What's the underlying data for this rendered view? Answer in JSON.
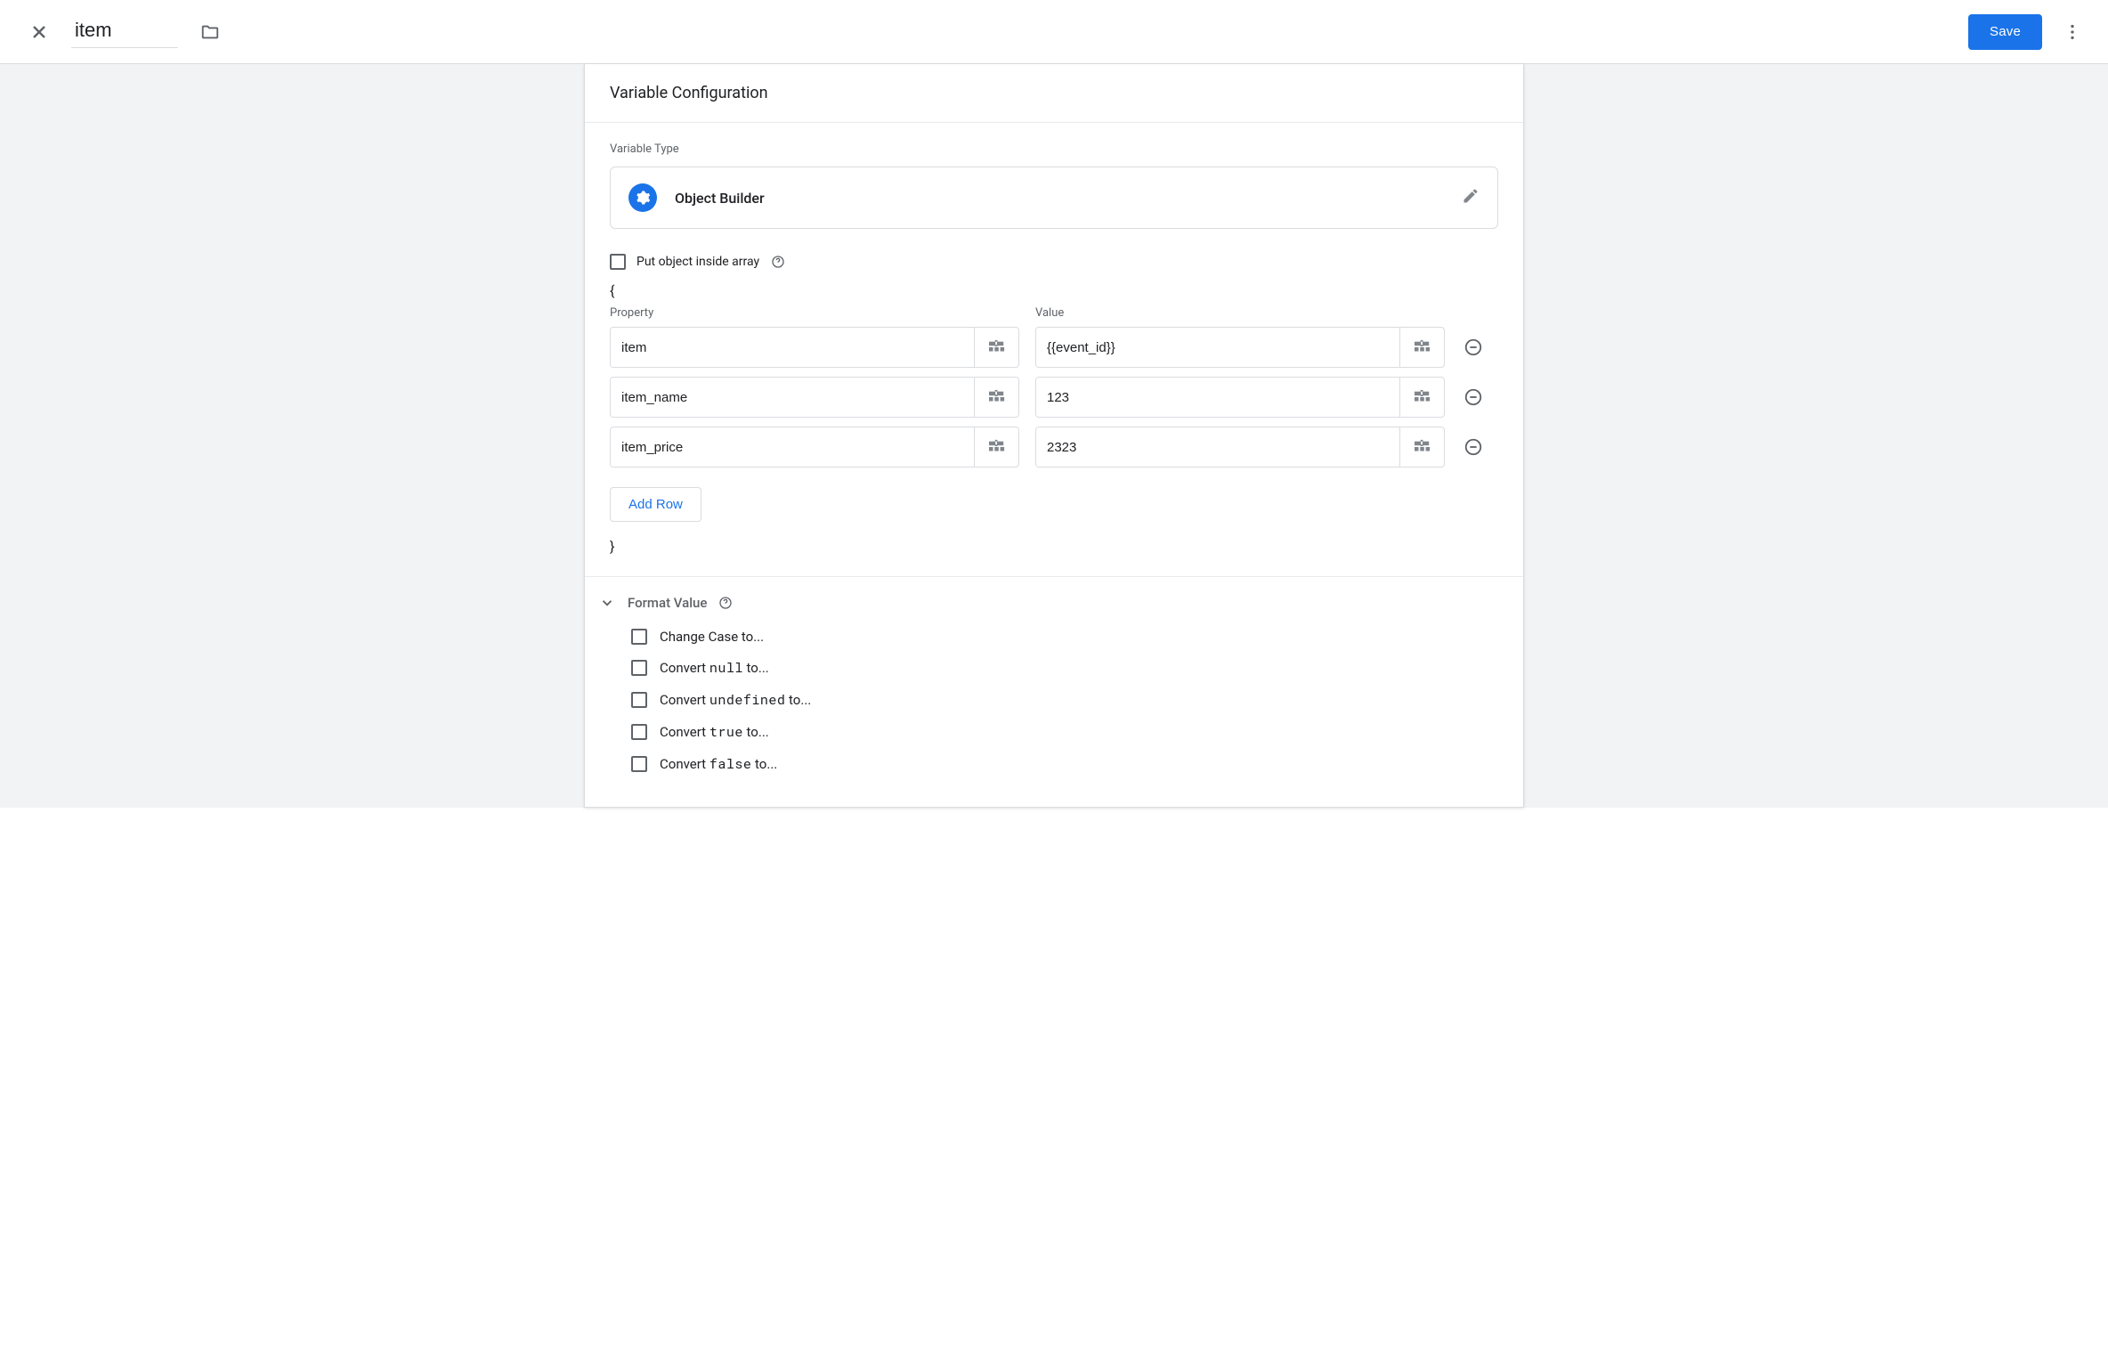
{
  "header": {
    "title_value": "item",
    "save_label": "Save"
  },
  "config": {
    "panel_title": "Variable Configuration",
    "type_label": "Variable Type",
    "type_name": "Object Builder",
    "array_checkbox_label": "Put object inside array",
    "open_brace": "{",
    "close_brace": "}",
    "col_property": "Property",
    "col_value": "Value",
    "rows": [
      {
        "property": "item",
        "value": "{{event_id}}"
      },
      {
        "property": "item_name",
        "value": "123"
      },
      {
        "property": "item_price",
        "value": "2323"
      }
    ],
    "add_row_label": "Add Row"
  },
  "format": {
    "section_title": "Format Value",
    "items": [
      {
        "pre": "Change Case to...",
        "mono": "",
        "post": ""
      },
      {
        "pre": "Convert ",
        "mono": "null",
        "post": " to..."
      },
      {
        "pre": "Convert ",
        "mono": "undefined",
        "post": " to..."
      },
      {
        "pre": "Convert ",
        "mono": "true",
        "post": " to..."
      },
      {
        "pre": "Convert ",
        "mono": "false",
        "post": " to..."
      }
    ]
  }
}
